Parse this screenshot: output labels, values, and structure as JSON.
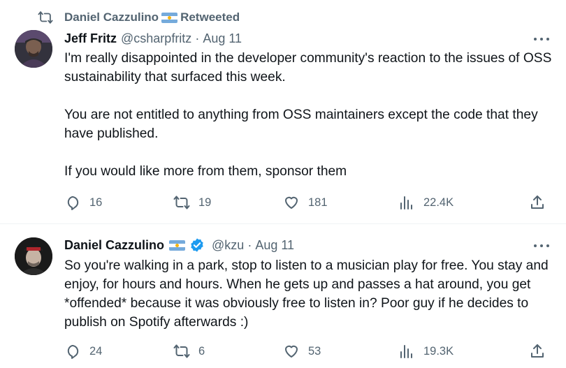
{
  "tweet1": {
    "social_context": "Daniel Cazzulino",
    "social_context_suffix": "Retweeted",
    "author_name": "Jeff Fritz",
    "handle": "@csharpfritz",
    "separator": "·",
    "date": "Aug 11",
    "paragraphs": [
      "I'm really disappointed in the developer community's reaction to the issues of OSS sustainability that surfaced this week.",
      "You are not entitled to anything from OSS maintainers except the code that they have published.",
      "If you would like more from them, sponsor them"
    ],
    "replies": "16",
    "retweets": "19",
    "likes": "181",
    "views": "22.4K"
  },
  "tweet2": {
    "author_name": "Daniel Cazzulino",
    "verified": true,
    "handle": "@kzu",
    "separator": "·",
    "date": "Aug 11",
    "text": "So you're walking in a park, stop to listen to a musician play for free. You stay and enjoy, for hours and hours. When he gets up and passes a hat around, you get *offended* because it was obviously free to listen in? Poor guy if he decides to publish on Spotify afterwards :)",
    "replies": "24",
    "retweets": "6",
    "likes": "53",
    "views": "19.3K"
  },
  "icons": [
    "retweet-icon",
    "flag-argentina-icon",
    "verified-badge-icon",
    "more-icon",
    "reply-icon",
    "like-icon",
    "views-icon",
    "share-icon"
  ],
  "colors": {
    "text": "#0f1419",
    "secondary": "#536471",
    "verified": "#1d9bf0",
    "divider": "#eff3f4"
  }
}
